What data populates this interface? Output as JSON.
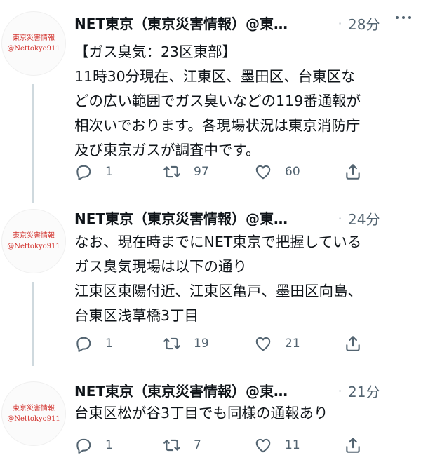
{
  "tweets": [
    {
      "avatar_line1": "東京災害情報",
      "avatar_line2": "@Nettokyo911",
      "name": "NET東京（東京災害情報）@東…",
      "separator": "·",
      "time": "28分",
      "lines": [
        "【ガス臭気：23区東部】",
        "11時30分現在、江東区、墨田区、台東区な",
        "どの広い範囲でガス臭いなどの119番通報が",
        "相次いでおります。各現場状況は東京消防庁",
        "及び東京ガスが調査中です。"
      ],
      "replies": "1",
      "retweets": "97",
      "likes": "60"
    },
    {
      "avatar_line1": "東京災害情報",
      "avatar_line2": "@Nettokyo911",
      "name": "NET東京（東京災害情報）@東…",
      "separator": "·",
      "time": "24分",
      "lines": [
        "なお、現在時までにNET東京で把握している",
        "ガス臭気現場は以下の通り",
        "江東区東陽付近、江東区亀戸、墨田区向島、",
        "台東区浅草橋3丁目"
      ],
      "replies": "1",
      "retweets": "19",
      "likes": "21"
    },
    {
      "avatar_line1": "東京災害情報",
      "avatar_line2": "@Nettokyo911",
      "name": "NET東京（東京災害情報）@東…",
      "separator": "·",
      "time": "21分",
      "lines": [
        "台東区松が谷3丁目でも同様の通報あり"
      ],
      "replies": "1",
      "retweets": "7",
      "likes": "11"
    }
  ],
  "icons": {
    "reply": "reply-icon",
    "retweet": "retweet-icon",
    "like": "heart-icon",
    "share": "share-icon",
    "more": "more-icon"
  },
  "colors": {
    "avatar_text": "#d2312c",
    "secondary_text": "#536471",
    "thread_line": "#cfd9de"
  }
}
